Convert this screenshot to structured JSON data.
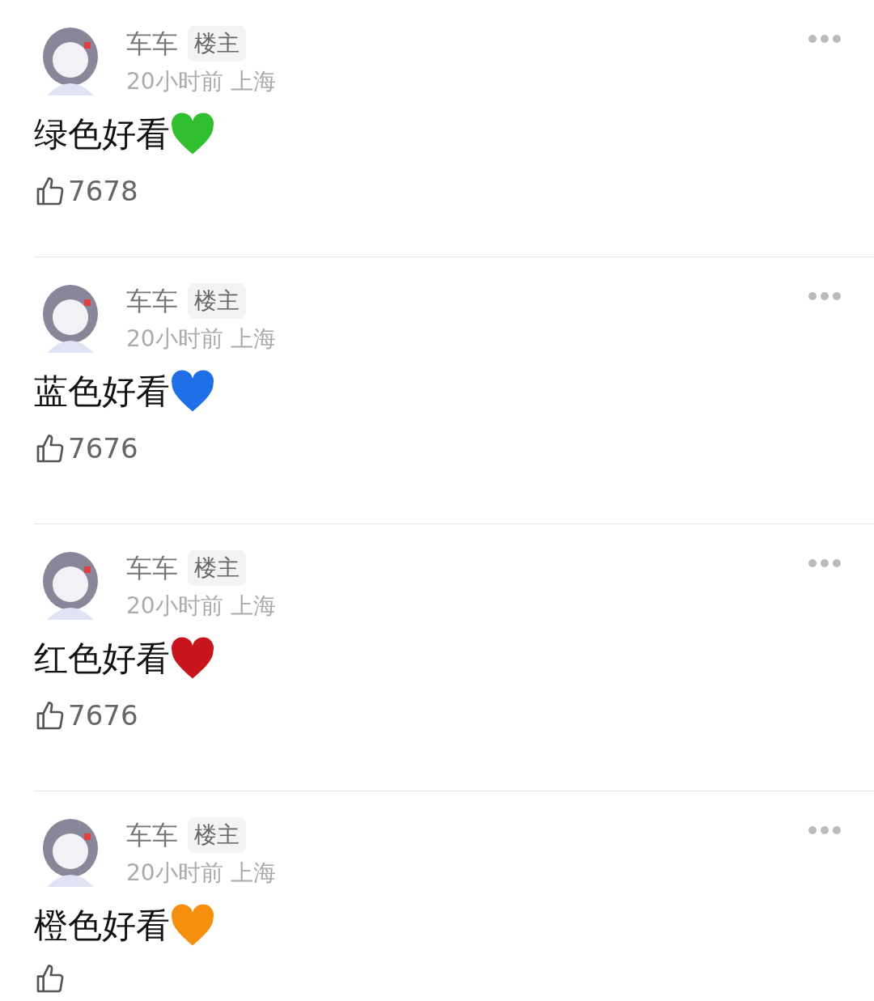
{
  "comments": [
    {
      "author": "车车",
      "badge": "楼主",
      "meta": "20小时前 上海",
      "text": "绿色好看",
      "color": "#2fbf2f",
      "likes": "7678"
    },
    {
      "author": "车车",
      "badge": "楼主",
      "meta": "20小时前 上海",
      "text": "蓝色好看",
      "color": "#1f6fe8",
      "likes": "7676"
    },
    {
      "author": "车车",
      "badge": "楼主",
      "meta": "20小时前 上海",
      "text": "红色好看",
      "color": "#c8141c",
      "likes": "7676"
    },
    {
      "author": "车车",
      "badge": "楼主",
      "meta": "20小时前 上海",
      "text": "橙色好看",
      "color": "#f5900f"
    }
  ]
}
